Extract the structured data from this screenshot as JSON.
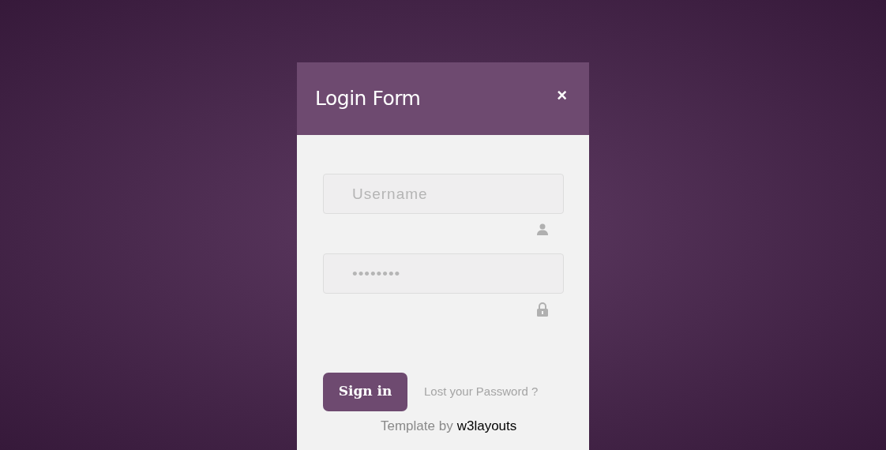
{
  "dialog": {
    "title": "Login Form",
    "close": "×"
  },
  "fields": [
    {
      "kind": "user",
      "placeholder": "Username"
    },
    {
      "kind": "lock",
      "value": "••••••••"
    }
  ],
  "sign_in": "Sign in",
  "lost_password": "Lost your Password ?",
  "credit": {
    "text": "Template by",
    "link": "w3layouts"
  }
}
